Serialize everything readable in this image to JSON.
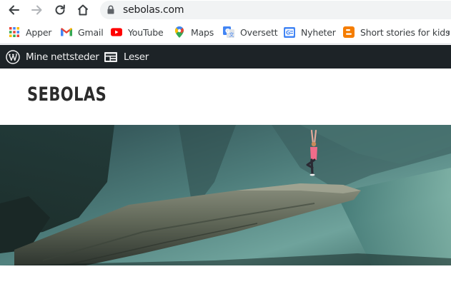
{
  "browser": {
    "url": "sebolas.com",
    "icons": {
      "back": "arrow-left-icon",
      "forward": "arrow-right-icon",
      "reload": "reload-icon",
      "home": "home-icon",
      "lock": "lock-icon"
    }
  },
  "bookmarks": [
    {
      "label": "Apper",
      "icon": "apps-grid-icon"
    },
    {
      "label": "Gmail",
      "icon": "gmail-icon"
    },
    {
      "label": "YouTube",
      "icon": "youtube-icon"
    },
    {
      "label": "Maps",
      "icon": "maps-pin-icon"
    },
    {
      "label": "Oversett",
      "icon": "translate-icon"
    },
    {
      "label": "Nyheter",
      "icon": "news-icon"
    },
    {
      "label": "Short stories for kids",
      "icon": "blogger-icon"
    }
  ],
  "adminbar": {
    "my_sites": "Mine nettsteder",
    "reader": "Leser"
  },
  "site": {
    "title": "SEBOLAS"
  },
  "colors": {
    "adminbar_bg": "#1d2327",
    "omnibox_bg": "#f1f3f4",
    "title_text": "#2b2b2b"
  }
}
